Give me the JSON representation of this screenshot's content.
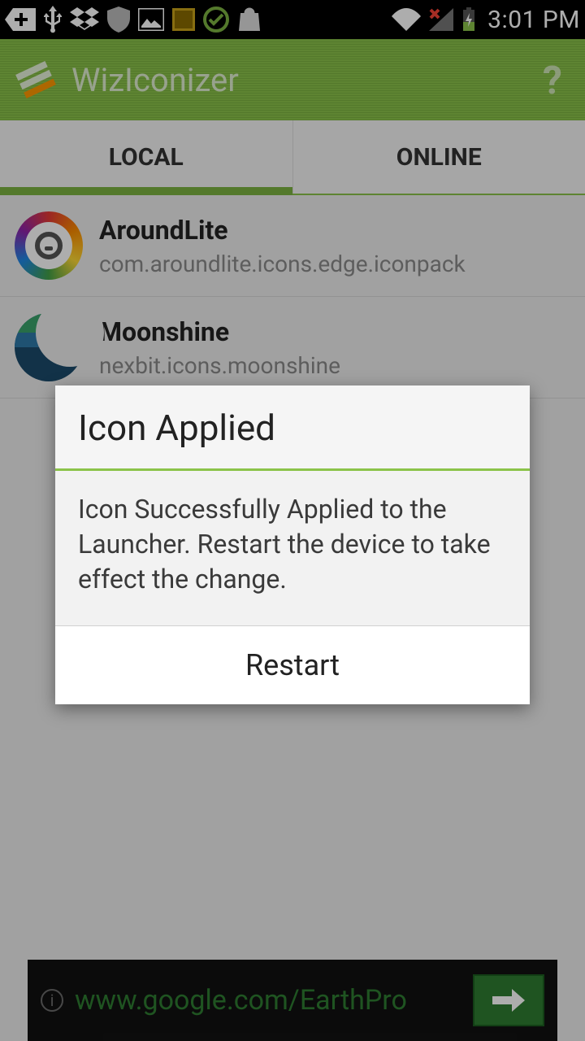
{
  "status": {
    "time": "3:01 PM"
  },
  "appbar": {
    "title": "WizIconizer"
  },
  "tabs": {
    "local": "LOCAL",
    "online": "ONLINE",
    "active": "local"
  },
  "packs": [
    {
      "name": "AroundLite",
      "package": "com.aroundlite.icons.edge.iconpack"
    },
    {
      "name": "Moonshine",
      "package": "nexbit.icons.moonshine"
    }
  ],
  "dialog": {
    "title": "Icon Applied",
    "body": "Icon Successfully Applied to the Launcher. Restart the device to take effect the change.",
    "action": "Restart"
  },
  "ad": {
    "url": "www.google.com/EarthPro"
  }
}
